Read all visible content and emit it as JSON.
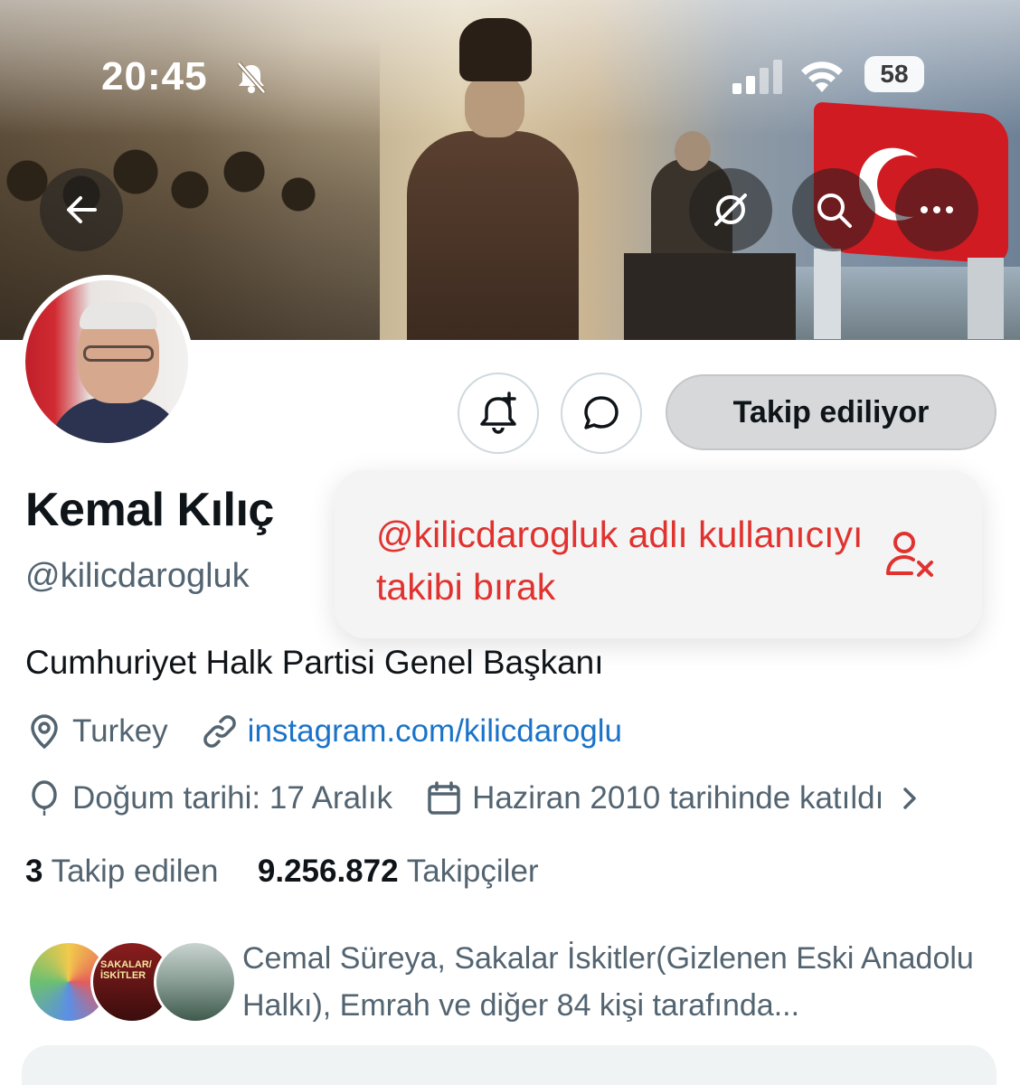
{
  "status_bar": {
    "time": "20:45",
    "battery": "58",
    "icons": [
      "bell-slash-icon",
      "signal-icon",
      "wifi-icon",
      "battery-icon"
    ]
  },
  "banner": {
    "buttons": [
      "back-arrow-icon",
      "grok-icon",
      "search-icon",
      "more-icon"
    ]
  },
  "profile": {
    "display_name": "Kemal Kılıç",
    "handle": "@kilicdarogluk",
    "bio": "Cumhuriyet Halk Partisi Genel Başkanı",
    "location": "Turkey",
    "website": "instagram.com/kilicdaroglu",
    "birthday": "Doğum tarihi: 17 Aralık",
    "joined": "Haziran 2010 tarihinde katıldı"
  },
  "actions": {
    "follow_label": "Takip ediliyor",
    "icons": [
      "bell-plus-icon",
      "message-icon"
    ]
  },
  "popup": {
    "text": "@kilicdarogluk adlı kullanıcıyı takibi bırak",
    "icon": "user-remove-icon"
  },
  "stats": {
    "following_count": "3",
    "following_label": "Takip edilen",
    "followers_count": "9.256.872",
    "followers_label": "Takipçiler"
  },
  "mutuals": {
    "text": "Cemal Süreya, Sakalar İskitler(Gizlenen Eski Anadolu Halkı), Emrah ve diğer 84 kişi tarafında...",
    "avatar2_caption": "SAKALAR/İSKİTLER"
  },
  "colors": {
    "unfollow_red": "#e0332f",
    "link_blue": "#1a73c8",
    "secondary_text": "#536471"
  }
}
